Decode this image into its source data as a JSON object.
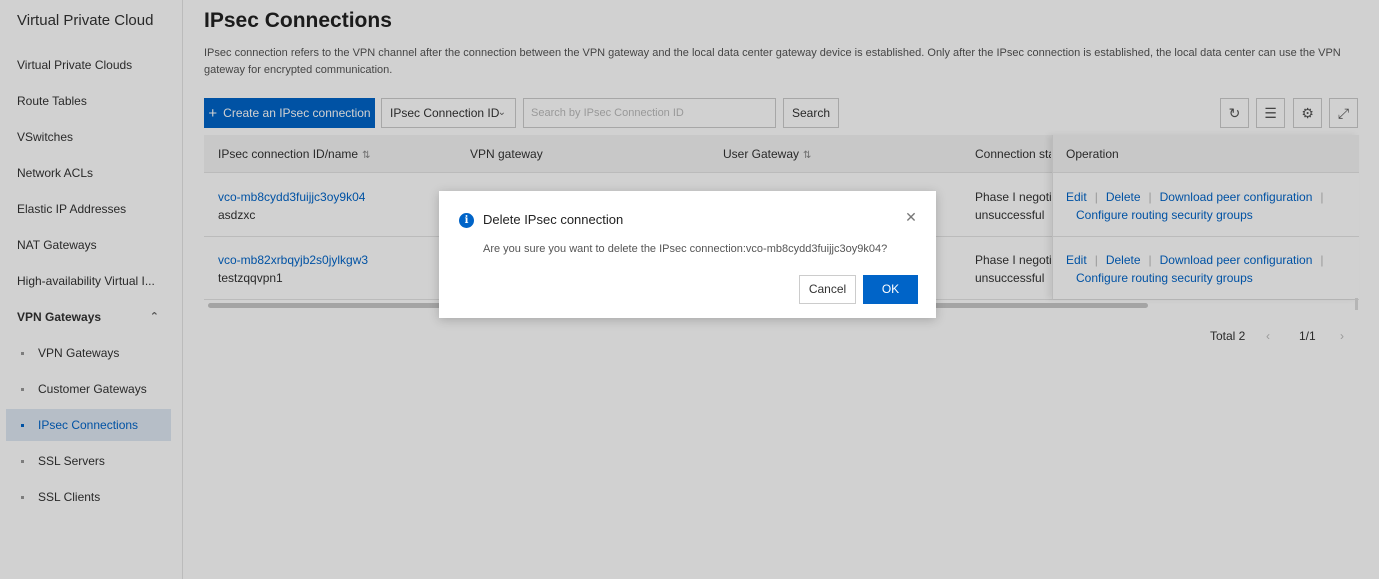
{
  "sidebar": {
    "title": "Virtual Private Cloud",
    "items": [
      {
        "label": "Virtual Private Clouds"
      },
      {
        "label": "Route Tables"
      },
      {
        "label": "VSwitches"
      },
      {
        "label": "Network ACLs"
      },
      {
        "label": "Elastic IP Addresses"
      },
      {
        "label": "NAT Gateways"
      },
      {
        "label": "High-availability Virtual I..."
      }
    ],
    "group": {
      "label": "VPN Gateways",
      "children": [
        {
          "label": "VPN Gateways"
        },
        {
          "label": "Customer Gateways"
        },
        {
          "label": "IPsec Connections",
          "active": true
        },
        {
          "label": "SSL Servers"
        },
        {
          "label": "SSL Clients"
        }
      ]
    }
  },
  "page": {
    "title": "IPsec Connections",
    "description": "IPsec connection refers to the VPN channel after the connection between the VPN gateway and the local data center gateway device is established. Only after the IPsec connection is established, the local data center can use the VPN gateway for encrypted communication."
  },
  "toolbar": {
    "create_label": "Create an IPsec connection",
    "filter_select": "IPsec Connection ID",
    "search_placeholder": "Search by IPsec Connection ID",
    "search_label": "Search"
  },
  "table": {
    "columns": {
      "id_name": "IPsec connection ID/name",
      "vpn_gateway": "VPN gateway",
      "user_gateway": "User Gateway",
      "status": "Connection stat",
      "operation": "Operation"
    },
    "rows": [
      {
        "id": "vco-mb8cydd3fuijjc3oy9k04",
        "name": "asdzxc",
        "status_line1": "Phase I negotiat",
        "status_line2": "unsuccessful"
      },
      {
        "id": "vco-mb82xrbqyjb2s0jylkgw3",
        "name": "testzqqvpn1",
        "status_line1": "Phase I negotiat",
        "status_line2": "unsuccessful"
      }
    ],
    "actions": {
      "edit": "Edit",
      "delete": "Delete",
      "download": "Download peer configuration",
      "configure": "Configure routing security groups"
    }
  },
  "pagination": {
    "total": "Total 2",
    "page": "1/1"
  },
  "dialog": {
    "title": "Delete IPsec connection",
    "message": "Are you sure you want to delete the IPsec connection:vco-mb8cydd3fuijjc3oy9k04?",
    "cancel_label": "Cancel",
    "ok_label": "OK"
  },
  "colors": {
    "primary": "#0064c8",
    "active_nav_bg": "#dfe8f3"
  }
}
